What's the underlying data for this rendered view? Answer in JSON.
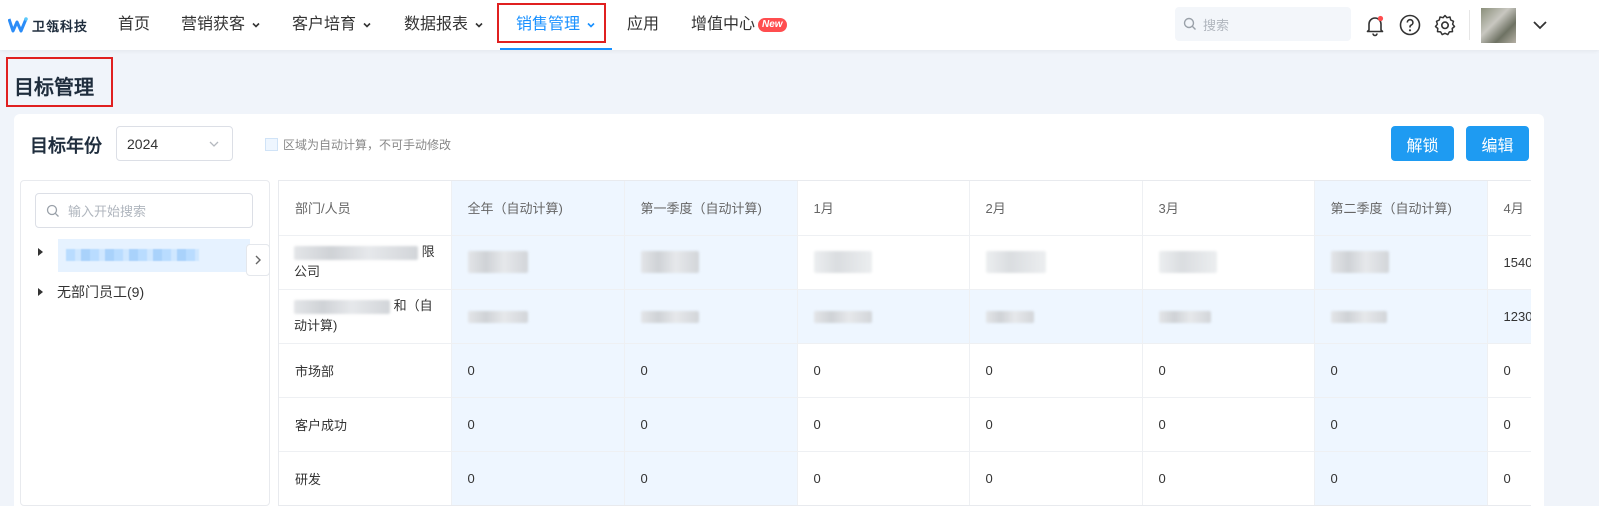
{
  "nav": {
    "logo_text": "卫瓴科技",
    "items": [
      {
        "label": "首页"
      },
      {
        "label": "营销获客"
      },
      {
        "label": "客户培育"
      },
      {
        "label": "数据报表"
      },
      {
        "label": "销售管理"
      },
      {
        "label": "应用"
      },
      {
        "label": "增值中心"
      }
    ],
    "new_badge": "New",
    "active_color": "#1890ff",
    "search_placeholder": "搜索"
  },
  "page": {
    "title": "目标管理"
  },
  "toolbar": {
    "year_label": "目标年份",
    "year_value": "2024",
    "legend_text": "区域为自动计算，不可手动修改",
    "unlock_label": "解锁",
    "edit_label": "编辑",
    "button_color": "#1e9bf2"
  },
  "tree": {
    "search_placeholder": "输入开始搜索",
    "nodes": [
      {
        "label": ""
      },
      {
        "label": "无部门员工(9)"
      }
    ]
  },
  "table": {
    "headers": [
      "部门/人员",
      "全年（自动计算)",
      "第一季度（自动计算)",
      "1月",
      "2月",
      "3月",
      "第二季度（自动计算)",
      "4月"
    ],
    "rows": [
      {
        "name_line1": "限",
        "name_line2": "公司",
        "cells": [
          "",
          "",
          "",
          "",
          "",
          "",
          "1540"
        ]
      },
      {
        "name_line1": "和（自",
        "name_line2": "动计算)",
        "cells": [
          "",
          "",
          "",
          "",
          "",
          "",
          "1230"
        ]
      },
      {
        "name": "市场部",
        "cells": [
          "0",
          "0",
          "0",
          "0",
          "0",
          "0",
          "0"
        ]
      },
      {
        "name": "客户成功",
        "cells": [
          "0",
          "0",
          "0",
          "0",
          "0",
          "0",
          "0"
        ]
      },
      {
        "name": "研发",
        "cells": [
          "0",
          "0",
          "0",
          "0",
          "0",
          "0",
          "0"
        ]
      }
    ]
  }
}
